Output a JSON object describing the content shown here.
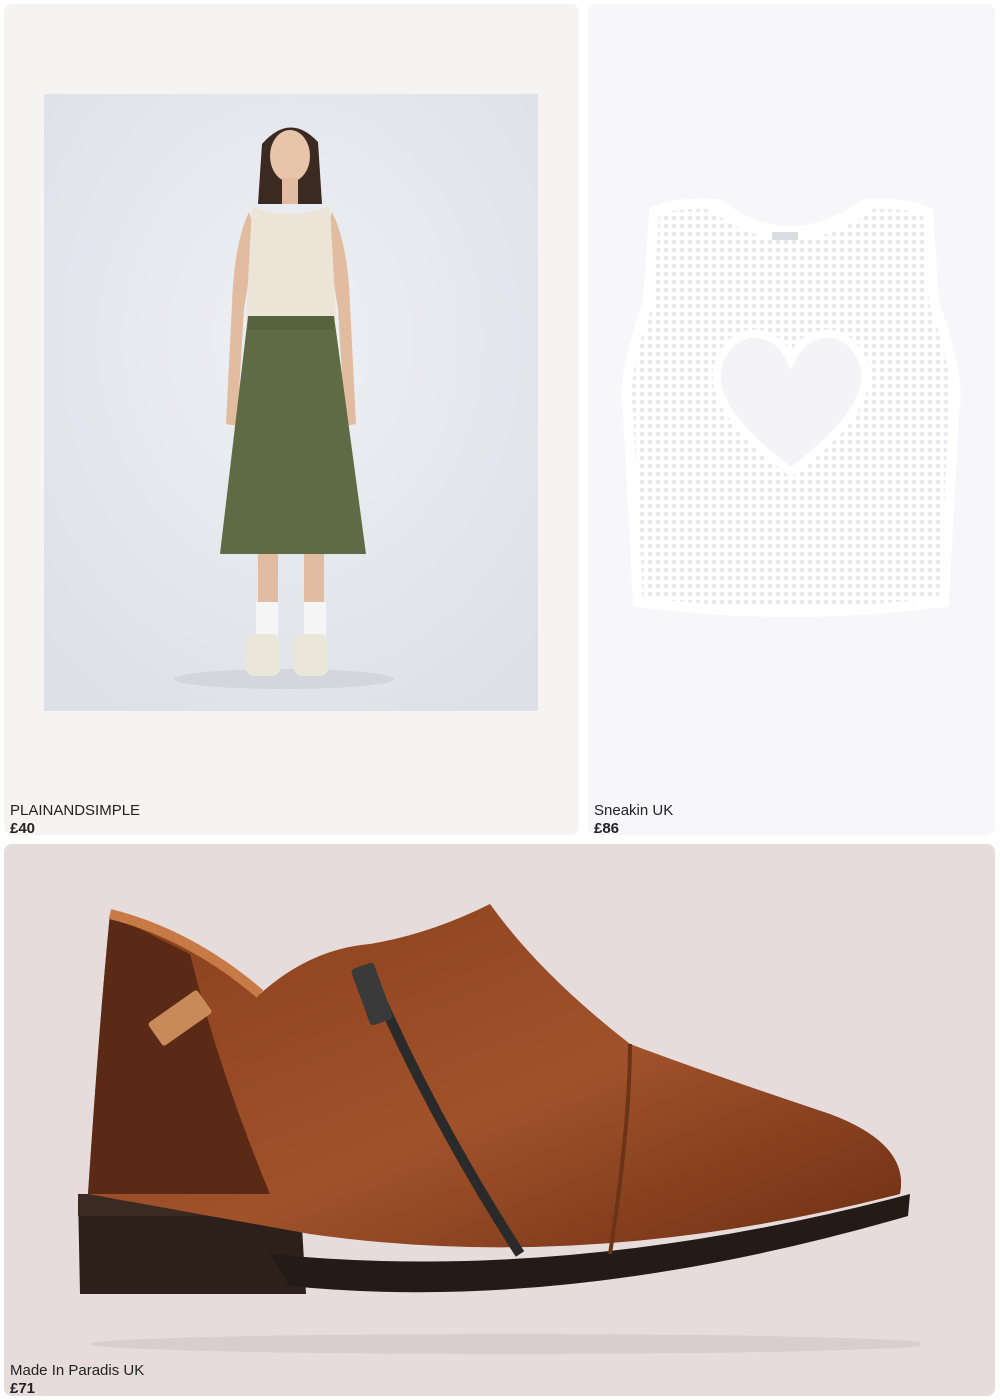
{
  "products": [
    {
      "brand": "PLAINANDSIMPLE",
      "price": "£40",
      "image": "model-wearing-olive-midi-skirt",
      "bg_color": "#f5f4f2"
    },
    {
      "brand": "Sneakin UK",
      "price": "£86",
      "image": "white-crochet-heart-knit-vest",
      "bg_color": "#f7f7f9"
    },
    {
      "brand": "Made In Paradis UK",
      "price": "£71",
      "image": "brown-leather-zip-ankle-shoe",
      "bg_color": "#e6dcdc"
    }
  ]
}
